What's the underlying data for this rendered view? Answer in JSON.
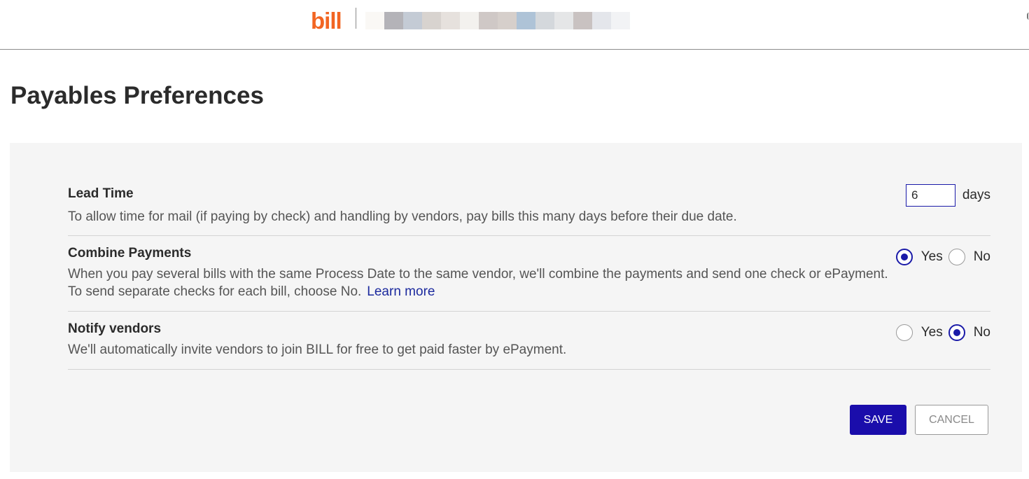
{
  "header": {
    "logo_text": "bill",
    "brand_color": "#f26522",
    "company_name_redacted_swatches": [
      "#faf8f5",
      "#b4b3b8",
      "#c4cbd5",
      "#d8d3cf",
      "#e6e1dd",
      "#f3f1ee",
      "#cfc8c6",
      "#d6cfcb",
      "#aec3d7",
      "#d4d8dc",
      "#e5e6e7",
      "#c9c2c1",
      "#e4e6eb",
      "#f2f3f5"
    ]
  },
  "page": {
    "title": "Payables Preferences"
  },
  "preferences": {
    "lead_time": {
      "title": "Lead Time",
      "description": "To allow time for mail (if paying by check) and handling by vendors, pay bills this many days before their due date.",
      "value": "6",
      "unit_label": "days"
    },
    "combine_payments": {
      "title": "Combine Payments",
      "description_line1": "When you pay several bills with the same Process Date to the same vendor, we'll combine the payments and send one check or ePayment.",
      "description_line2": "To send separate checks for each bill, choose No.",
      "learn_more": "Learn more",
      "yes_label": "Yes",
      "no_label": "No",
      "selected": "Yes"
    },
    "notify_vendors": {
      "title": "Notify vendors",
      "description": "We'll automatically invite vendors to join BILL for free to get paid faster by ePayment.",
      "yes_label": "Yes",
      "no_label": "No",
      "selected": "No"
    }
  },
  "actions": {
    "save_label": "SAVE",
    "cancel_label": "CANCEL",
    "primary_color": "#1a0dab"
  }
}
